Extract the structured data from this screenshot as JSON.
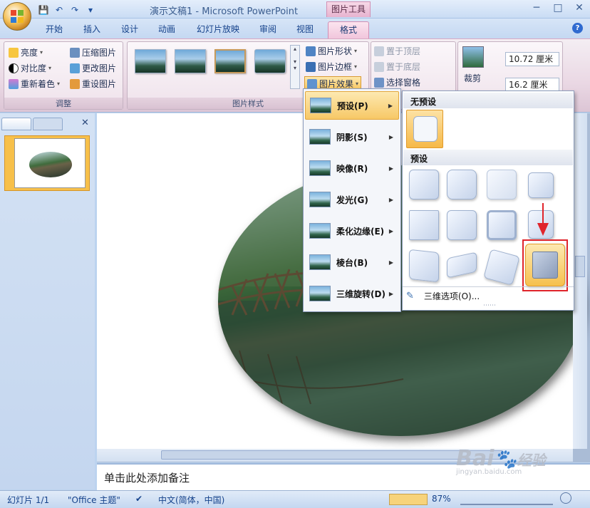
{
  "window": {
    "title": "演示文稿1 - Microsoft PowerPoint",
    "context_tab": "图片工具"
  },
  "qat": {
    "save": "💾",
    "undo": "↶",
    "redo": "↷",
    "customize": "▾"
  },
  "controls": {
    "min": "─",
    "max": "□",
    "close": "✕"
  },
  "tabs": [
    "开始",
    "插入",
    "设计",
    "动画",
    "幻灯片放映",
    "审阅",
    "视图",
    "格式"
  ],
  "help": "?",
  "ribbon": {
    "adjust": {
      "brightness": "亮度",
      "contrast": "对比度",
      "recolor": "重新着色",
      "compress": "压缩图片",
      "change": "更改图片",
      "reset": "重设图片",
      "label": "调整"
    },
    "styles": {
      "label": "图片样式",
      "shape": "图片形状",
      "border": "图片边框",
      "effects": "图片效果"
    },
    "arrange": {
      "front": "置于顶层",
      "back": "置于底层",
      "pane": "选择窗格"
    },
    "size": {
      "crop": "裁剪",
      "height": "10.72 厘米",
      "width": "16.2 厘米"
    }
  },
  "effects_menu": [
    "预设(P)",
    "阴影(S)",
    "映像(R)",
    "发光(G)",
    "柔化边缘(E)",
    "棱台(B)",
    "三维旋转(D)"
  ],
  "gallery": {
    "none_header": "无预设",
    "preset_header": "预设",
    "options": "三维选项(O)..."
  },
  "notes": "单击此处添加备注",
  "slide_number": "1",
  "status": {
    "slide": "幻灯片 1/1",
    "theme": "\"Office 主题\"",
    "lang": "中文(简体，中国)",
    "zoom": "87%"
  },
  "watermark": {
    "brand": "Bai",
    "brand2": "经验",
    "url": "jingyan.baidu.com"
  }
}
